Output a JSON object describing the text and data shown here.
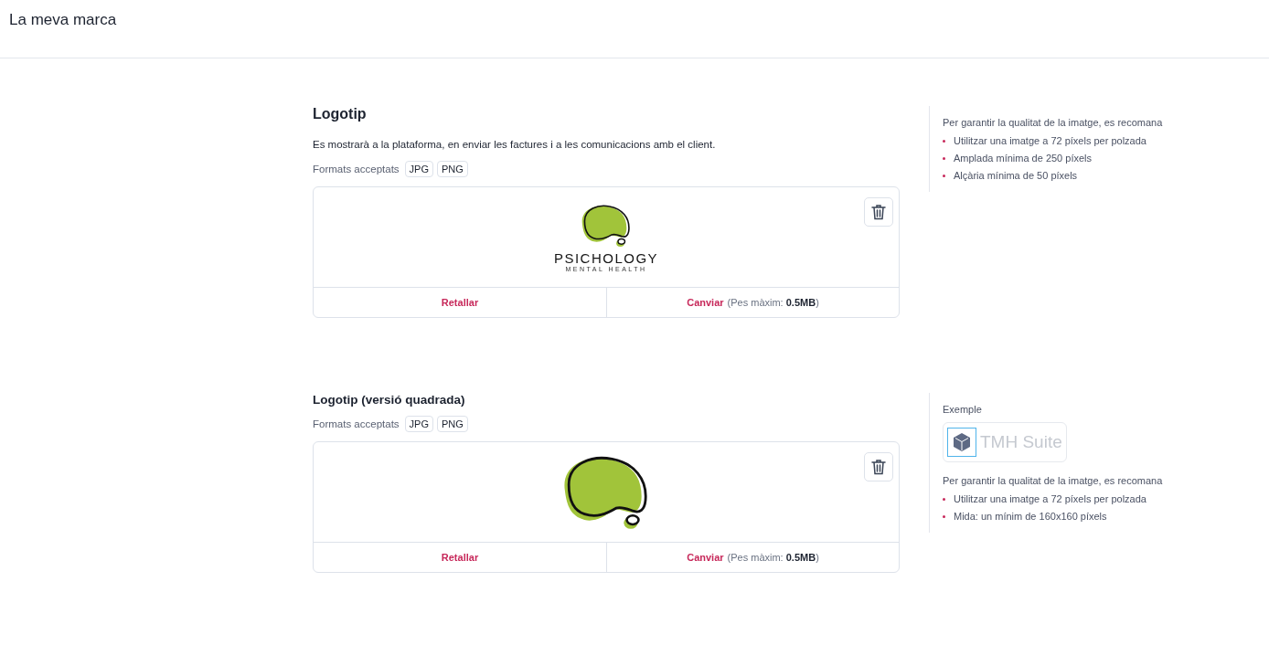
{
  "header": {
    "title": "La meva marca"
  },
  "sections": [
    {
      "kind": "main",
      "title": "Logotip",
      "description": "Es mostrarà a la plataforma, en enviar les factures i a les comunicacions amb el client.",
      "formats_label": "Formats acceptats",
      "formats": [
        "JPG",
        "PNG"
      ],
      "logo": {
        "kind": "full",
        "wordmark": "PSICHOLOGY",
        "tagline": "MENTAL HEALTH"
      },
      "actions": {
        "crop": "Retallar",
        "change": "Canviar",
        "limit": "(Pes màxim: **0.5MB**)"
      },
      "tips": {
        "intro": "Per garantir la qualitat de la imatge, es recomana",
        "items": [
          "Utilitzar una imatge a 72 píxels per polzada",
          "Amplada mínima de 250 píxels",
          "Alçària mínima de 50 píxels"
        ]
      }
    },
    {
      "kind": "sub",
      "title": "Logotip (versió quadrada)",
      "formats_label": "Formats acceptats",
      "formats": [
        "JPG",
        "PNG"
      ],
      "logo": {
        "kind": "square"
      },
      "actions": {
        "crop": "Retallar",
        "change": "Canviar",
        "limit": "(Pes màxim: **0.5MB**)"
      },
      "tips": {
        "example": {
          "label": "Exemple",
          "logo_text": "TMH Suite"
        },
        "intro": "Per garantir la qualitat de la imatge, es recomana",
        "items": [
          "Utilitzar una imatge a 72 píxels per polzada",
          "Mida: un mínim de 160x160 píxels"
        ]
      }
    }
  ]
}
